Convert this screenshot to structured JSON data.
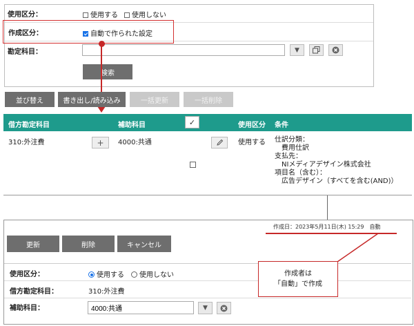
{
  "search": {
    "usage_label": "使用区分：",
    "usage_options": [
      "使用する",
      "使用しない"
    ],
    "creation_label": "作成区分：",
    "creation_option": "自動で作られた設定",
    "account_label": "勘定科目：",
    "account_value": "",
    "search_button": "検索"
  },
  "toolbar": {
    "sort": "並び替え",
    "export_import": "書き出し/読み込み",
    "bulk_update": "一括更新",
    "bulk_delete": "一括削除"
  },
  "table": {
    "headers": {
      "debit_account": "借方勘定科目",
      "sub_account": "補助科目",
      "check": "✓",
      "usage": "使用区分",
      "condition": "条件"
    },
    "row": {
      "debit_account": "310:外注費",
      "sub_account": "4000:共通",
      "usage": "使用する",
      "conditions": [
        "仕訳分類：",
        "　費用仕訳",
        "支払先：",
        "　NIメディアデザイン株式会社",
        "項目名（含む）：",
        "　広告デザイン（すべてを含む(AND)）"
      ]
    }
  },
  "detail": {
    "created_info": "作成日：2023年5月11日(木) 15:29　自動",
    "update_button": "更新",
    "delete_button": "削除",
    "cancel_button": "キャンセル",
    "usage_label": "使用区分：",
    "usage_options": [
      "使用する",
      "使用しない"
    ],
    "debit_label": "借方勘定科目：",
    "debit_value": "310:外注費",
    "sub_label": "補助科目：",
    "sub_value": "4000:共通"
  },
  "callout": {
    "line1": "作成者は",
    "line2": "「自動」で作成"
  },
  "colors": {
    "header_teal": "#1e9b8c",
    "annotation_red": "#d32f2f",
    "button_gray": "#6e6e6e"
  }
}
